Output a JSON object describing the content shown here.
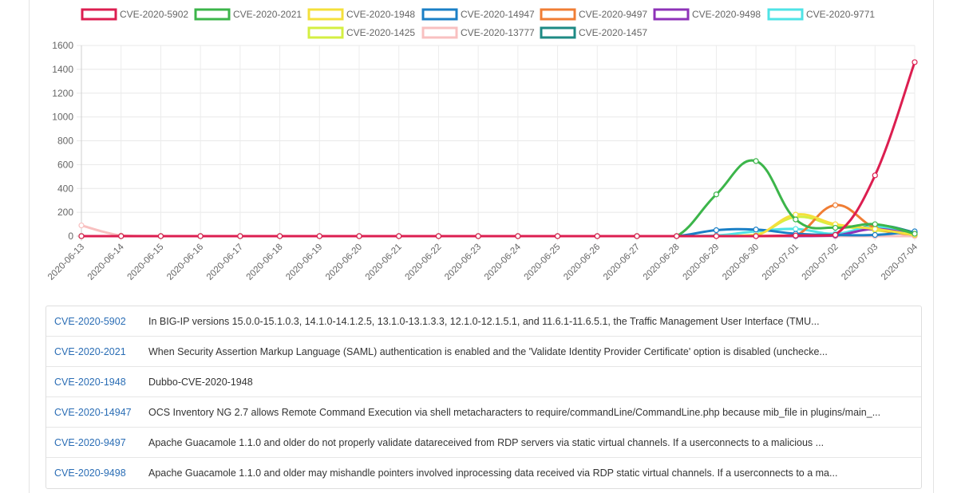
{
  "chart_data": {
    "type": "line",
    "x": [
      "2020-06-13",
      "2020-06-14",
      "2020-06-15",
      "2020-06-16",
      "2020-06-17",
      "2020-06-18",
      "2020-06-19",
      "2020-06-20",
      "2020-06-21",
      "2020-06-22",
      "2020-06-23",
      "2020-06-24",
      "2020-06-25",
      "2020-06-26",
      "2020-06-27",
      "2020-06-28",
      "2020-06-29",
      "2020-06-30",
      "2020-07-01",
      "2020-07-02",
      "2020-07-03",
      "2020-07-04"
    ],
    "ylim": [
      0,
      1600
    ],
    "yticks": [
      0,
      200,
      400,
      600,
      800,
      1000,
      1200,
      1400,
      1600
    ],
    "grid": true,
    "legend_position": "top-center",
    "series": [
      {
        "name": "CVE-2020-5902",
        "color": "#dc1e50",
        "values": [
          0,
          0,
          0,
          0,
          0,
          0,
          0,
          0,
          0,
          0,
          0,
          0,
          0,
          0,
          0,
          0,
          0,
          0,
          5,
          10,
          510,
          1460
        ]
      },
      {
        "name": "CVE-2020-2021",
        "color": "#3cb54a",
        "values": [
          0,
          0,
          0,
          0,
          0,
          0,
          0,
          0,
          0,
          0,
          0,
          0,
          0,
          0,
          0,
          0,
          350,
          630,
          140,
          70,
          100,
          20
        ]
      },
      {
        "name": "CVE-2020-1948",
        "color": "#f4e03c",
        "values": [
          0,
          0,
          0,
          0,
          0,
          0,
          0,
          0,
          0,
          0,
          0,
          0,
          0,
          0,
          0,
          0,
          0,
          5,
          180,
          100,
          60,
          10
        ]
      },
      {
        "name": "CVE-2020-14947",
        "color": "#1a7fc6",
        "values": [
          0,
          0,
          0,
          0,
          0,
          0,
          0,
          0,
          0,
          0,
          0,
          0,
          0,
          0,
          0,
          0,
          50,
          55,
          20,
          10,
          10,
          40
        ]
      },
      {
        "name": "CVE-2020-9497",
        "color": "#f07d34",
        "values": [
          0,
          0,
          0,
          0,
          0,
          0,
          0,
          0,
          0,
          0,
          0,
          0,
          0,
          0,
          0,
          0,
          0,
          0,
          5,
          260,
          70,
          10
        ]
      },
      {
        "name": "CVE-2020-9498",
        "color": "#8e32b8",
        "values": [
          0,
          0,
          0,
          0,
          0,
          0,
          0,
          0,
          0,
          0,
          0,
          0,
          0,
          0,
          0,
          0,
          0,
          0,
          0,
          5,
          60,
          10
        ]
      },
      {
        "name": "CVE-2020-9771",
        "color": "#4fe3e6",
        "values": [
          0,
          0,
          0,
          0,
          0,
          0,
          0,
          0,
          0,
          0,
          0,
          0,
          0,
          0,
          0,
          0,
          5,
          40,
          60,
          20,
          80,
          10
        ]
      },
      {
        "name": "CVE-2020-1425",
        "color": "#d4ef42",
        "values": [
          0,
          0,
          0,
          0,
          0,
          0,
          0,
          0,
          0,
          0,
          0,
          0,
          0,
          0,
          0,
          0,
          0,
          10,
          160,
          90,
          50,
          10
        ]
      },
      {
        "name": "CVE-2020-13777",
        "color": "#f8c0c0",
        "values": [
          90,
          5,
          0,
          0,
          0,
          0,
          0,
          0,
          0,
          0,
          0,
          0,
          0,
          0,
          0,
          0,
          0,
          0,
          0,
          0,
          0,
          0
        ]
      },
      {
        "name": "CVE-2020-1457",
        "color": "#1e8a84",
        "values": [
          0,
          0,
          0,
          0,
          0,
          0,
          0,
          0,
          0,
          0,
          0,
          0,
          0,
          0,
          0,
          0,
          0,
          0,
          0,
          0,
          90,
          30
        ]
      }
    ]
  },
  "cve_list": [
    {
      "id": "CVE-2020-5902",
      "desc": "In BIG-IP versions 15.0.0-15.1.0.3, 14.1.0-14.1.2.5, 13.1.0-13.1.3.3, 12.1.0-12.1.5.1, and 11.6.1-11.6.5.1, the Traffic Management User Interface (TMU..."
    },
    {
      "id": "CVE-2020-2021",
      "desc": "When Security Assertion Markup Language (SAML) authentication is enabled and the 'Validate Identity Provider Certificate' option is disabled (unchecke..."
    },
    {
      "id": "CVE-2020-1948",
      "desc": "Dubbo-CVE-2020-1948"
    },
    {
      "id": "CVE-2020-14947",
      "desc": "OCS Inventory NG 2.7 allows Remote Command Execution via shell metacharacters to require/commandLine/CommandLine.php because mib_file in plugins/main_..."
    },
    {
      "id": "CVE-2020-9497",
      "desc": "Apache Guacamole 1.1.0 and older do not properly validate datareceived from RDP servers via static virtual channels. If a userconnects to a malicious ..."
    },
    {
      "id": "CVE-2020-9498",
      "desc": "Apache Guacamole 1.1.0 and older may mishandle pointers involved inprocessing data received via RDP static virtual channels. If a userconnects to a ma..."
    }
  ]
}
